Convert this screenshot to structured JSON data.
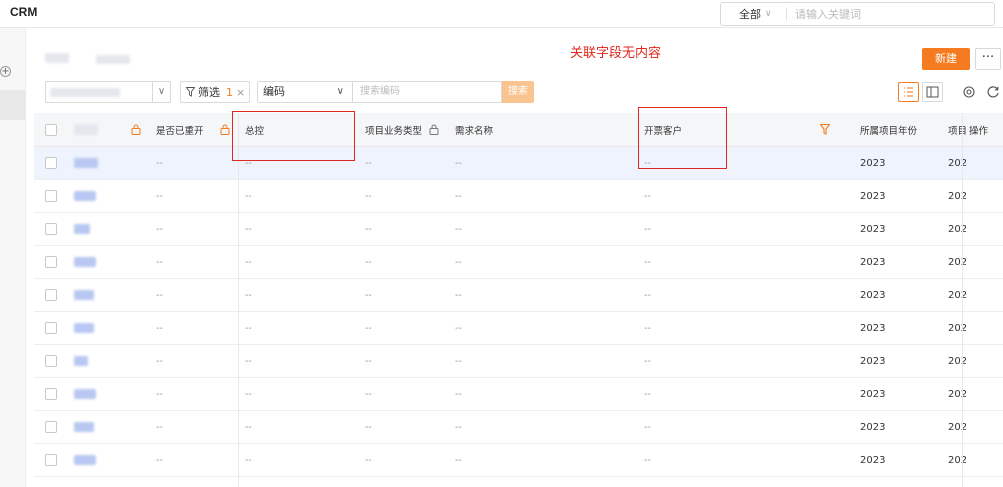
{
  "topbar": {
    "app_title": "CRM",
    "search_scope": "全部",
    "search_placeholder": "请输入关键词"
  },
  "annotation": "关联字段无内容",
  "toolbar": {
    "new_button": "新建",
    "more_button": "···",
    "filter_label": "筛选",
    "filter_count": "1",
    "field_select": "编码",
    "search_placeholder": "搜索编码",
    "search_button": "搜索"
  },
  "table": {
    "columns": [
      {
        "key": "reopened",
        "label": "是否已重开"
      },
      {
        "key": "master",
        "label": "总控"
      },
      {
        "key": "biz_type",
        "label": "项目业务类型"
      },
      {
        "key": "demand",
        "label": "需求名称"
      },
      {
        "key": "invoice_customer",
        "label": "开票客户"
      },
      {
        "key": "project_year",
        "label": "所属项目年份"
      },
      {
        "key": "project_short",
        "label": "项目"
      },
      {
        "key": "actions",
        "label": "操作"
      }
    ],
    "empty_value": "--",
    "rows": [
      {
        "year": "2023",
        "short": "202"
      },
      {
        "year": "2023",
        "short": "202"
      },
      {
        "year": "2023",
        "short": "202"
      },
      {
        "year": "2023",
        "short": "202"
      },
      {
        "year": "2023",
        "short": "202"
      },
      {
        "year": "2023",
        "short": "202"
      },
      {
        "year": "2023",
        "short": "202"
      },
      {
        "year": "2023",
        "short": "202"
      },
      {
        "year": "2023",
        "short": "202"
      },
      {
        "year": "2023",
        "short": "202"
      }
    ]
  },
  "colors": {
    "accent": "#f47b20",
    "highlight": "#e0271d",
    "selected_row": "#eef3fd"
  }
}
